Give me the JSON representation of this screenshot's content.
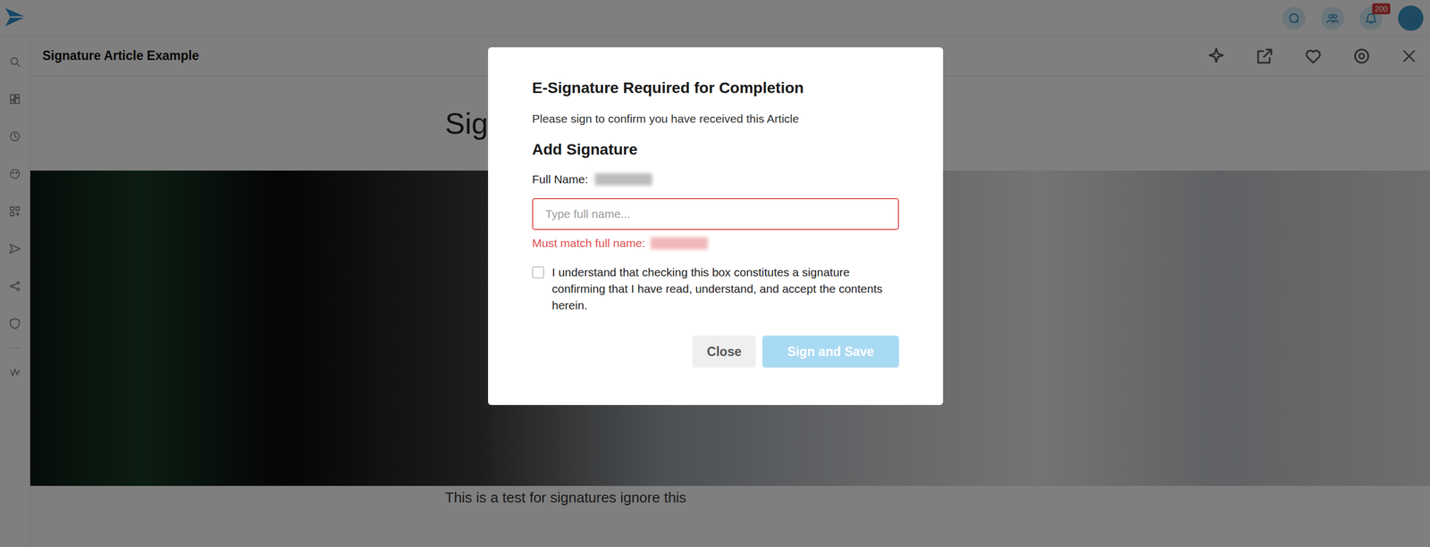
{
  "app": {
    "notifications_badge": "200"
  },
  "article": {
    "title": "Signature Article Example",
    "heading": "Sig",
    "body": "This is a test for signatures ignore this"
  },
  "dialog": {
    "title": "E-Signature Required for Completion",
    "subtitle": "Please sign to confirm you have received this Article",
    "section": "Add Signature",
    "full_name_label": "Full Name:",
    "input": {
      "placeholder": "Type full name...",
      "value": "",
      "invalid": true
    },
    "error": "Must match full name:",
    "checkbox": {
      "label": "I understand that checking this box constitutes a signature confirming that I have read, understand, and accept the contents herein.",
      "checked": false
    },
    "buttons": [
      {
        "label": "Close",
        "disabled": false
      },
      {
        "label": "Sign and Save",
        "disabled": true
      }
    ]
  }
}
